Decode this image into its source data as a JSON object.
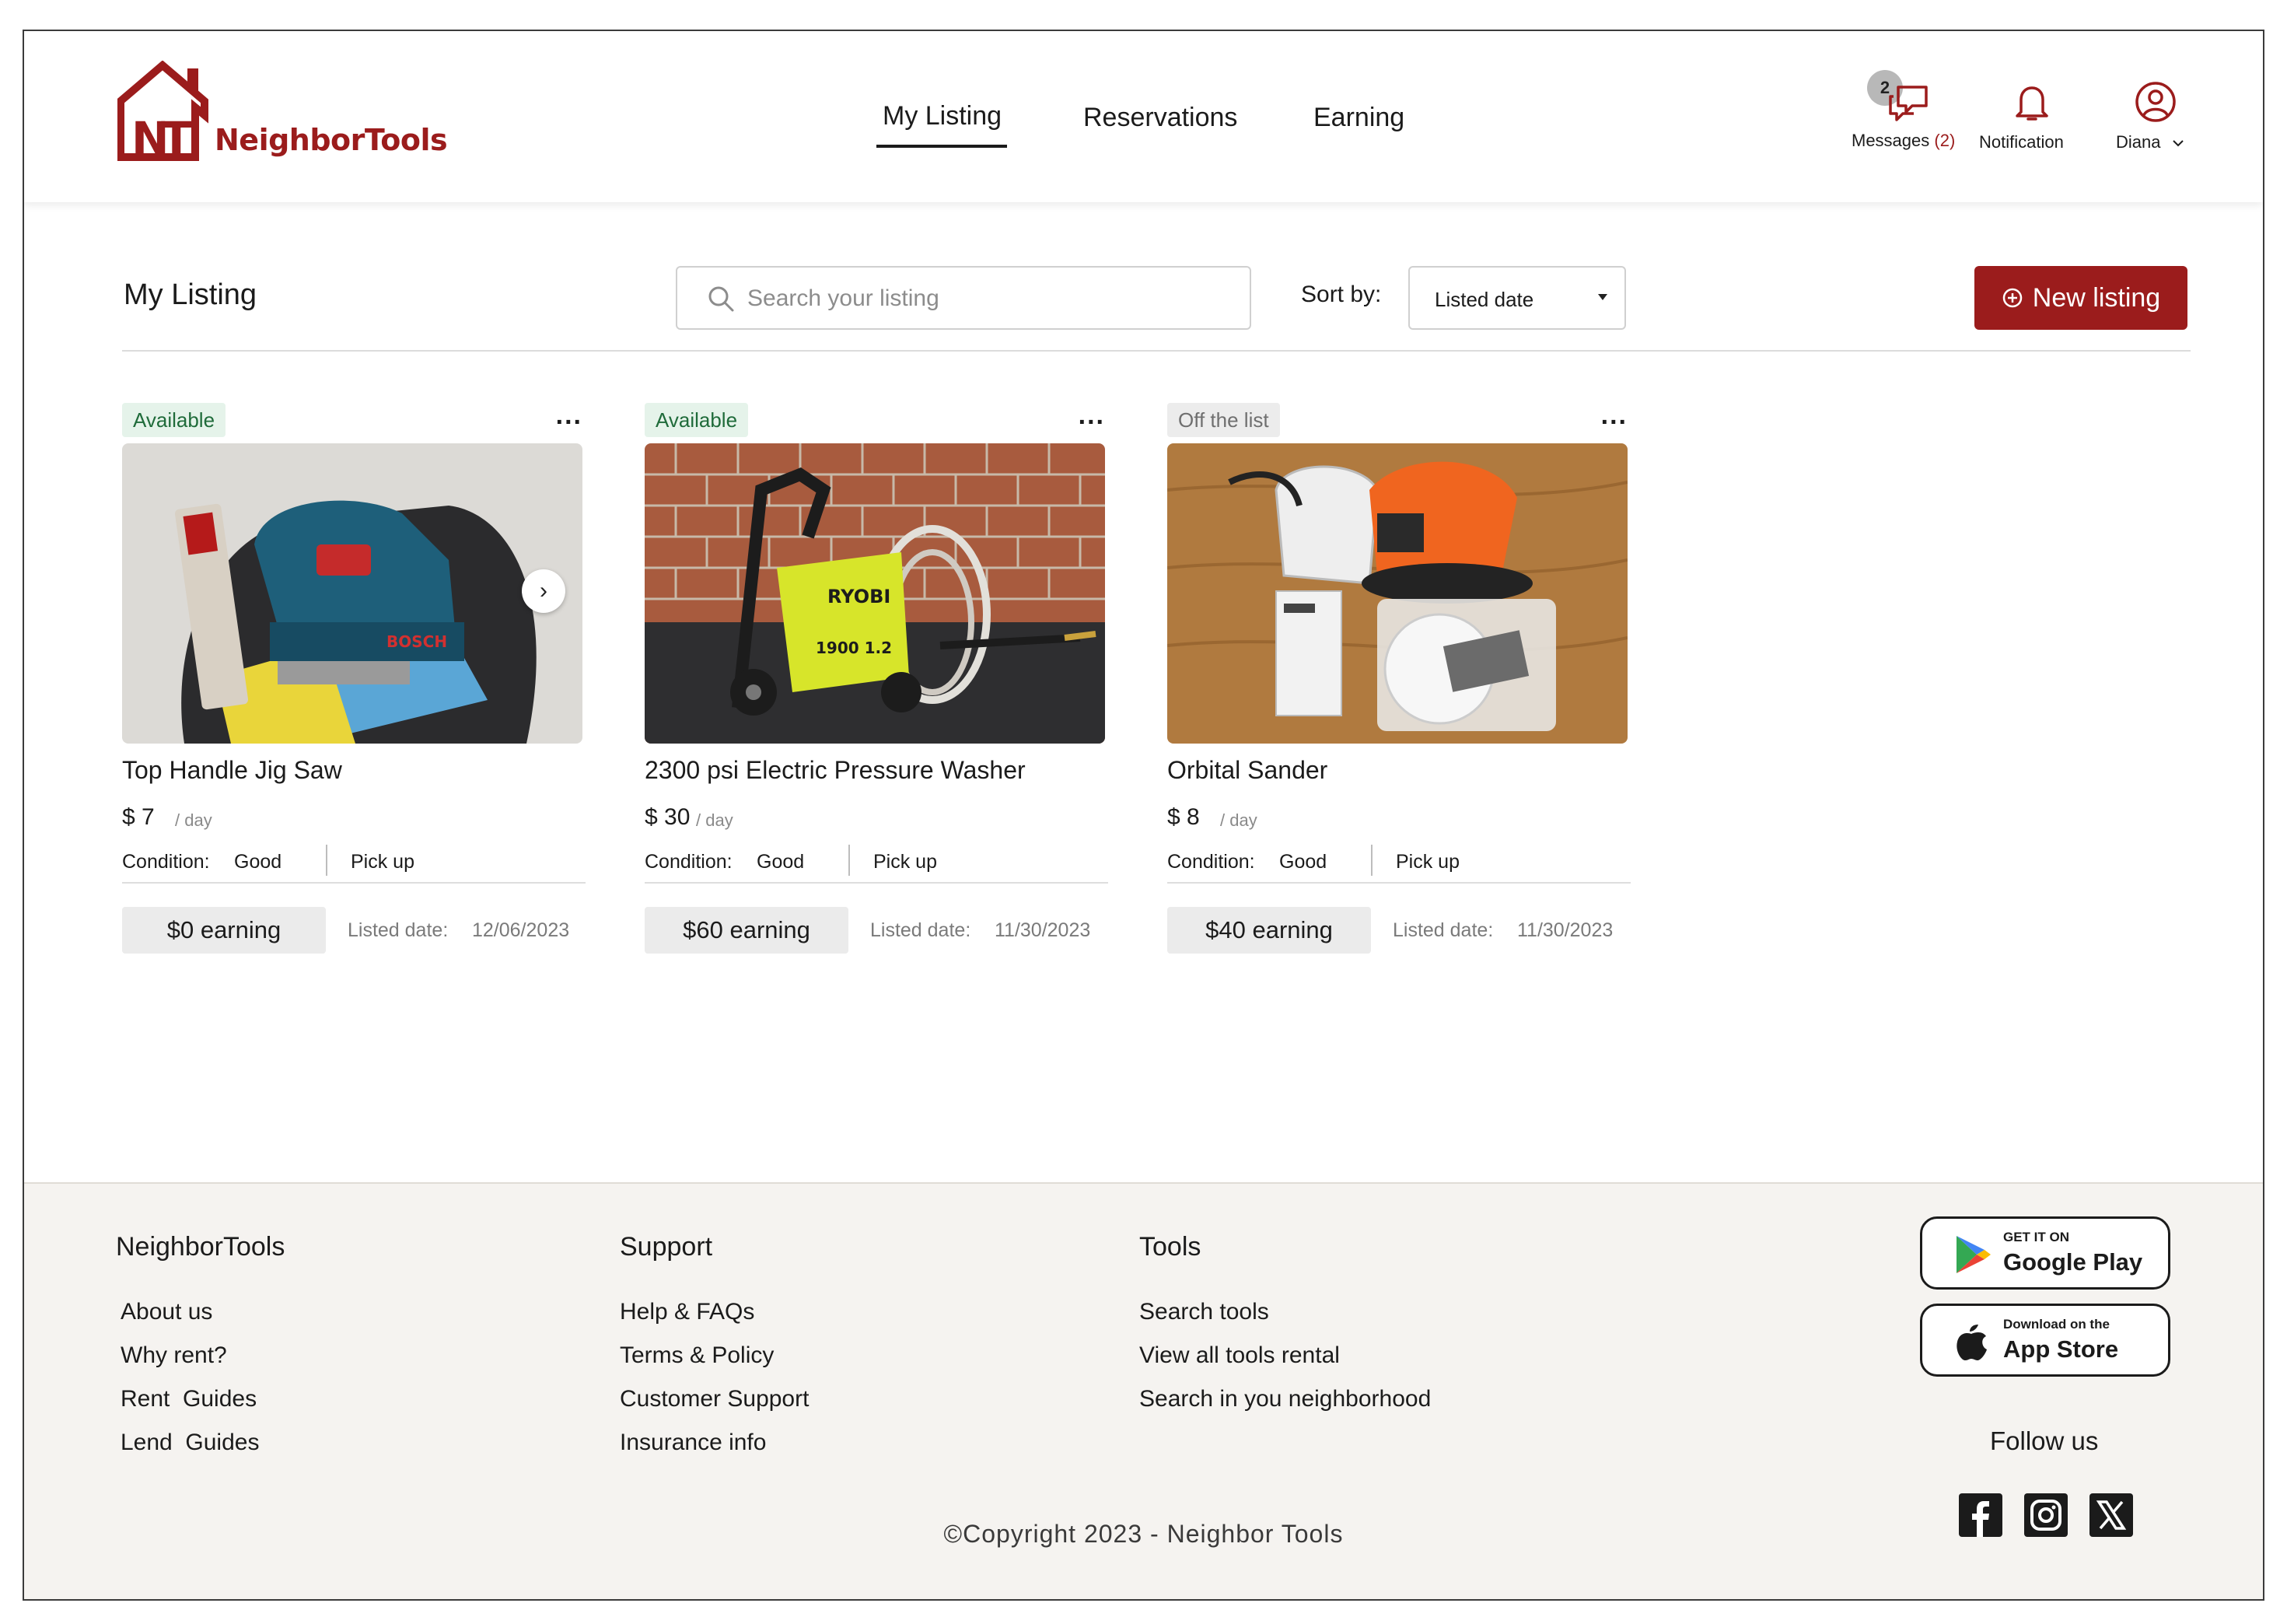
{
  "brand": {
    "name": "NeighborTools",
    "logo_letters": "NT",
    "color": "#9b1c1c"
  },
  "nav": {
    "items": [
      {
        "label": "My Listing"
      },
      {
        "label": "Reservations"
      },
      {
        "label": "Earning"
      }
    ]
  },
  "header": {
    "messages_label": "Messages",
    "messages_count": "(2)",
    "messages_badge": "2",
    "notification_label": "Notification",
    "user_name": "Diana"
  },
  "toolbar": {
    "title": "My Listing",
    "search_placeholder": "Search your listing",
    "sort_label": "Sort by:",
    "sort_value": "Listed date",
    "new_listing_label": "New listing"
  },
  "listings": [
    {
      "status": "Available",
      "title": "Top Handle Jig Saw",
      "price": "$ 7",
      "per_day": "/ day",
      "condition_label": "Condition:",
      "condition": "Good",
      "delivery": "Pick up",
      "earning": "$0 earning",
      "listed_label": "Listed date:",
      "listed_date": "12/06/2023"
    },
    {
      "status": "Available",
      "title": "2300 psi Electric Pressure Washer",
      "price": "$ 30",
      "per_day": "/ day",
      "condition_label": "Condition:",
      "condition": "Good",
      "delivery": "Pick up",
      "earning": "$60 earning",
      "listed_label": "Listed date:",
      "listed_date": "11/30/2023"
    },
    {
      "status": "Off the list",
      "title": "Orbital Sander",
      "price": "$ 8",
      "per_day": "/ day",
      "condition_label": "Condition:",
      "condition": "Good",
      "delivery": "Pick up",
      "earning": "$40 earning",
      "listed_label": "Listed date:",
      "listed_date": "11/30/2023"
    }
  ],
  "footer": {
    "col1": {
      "heading": "NeighborTools",
      "links": [
        "About us",
        "Why rent?",
        "Rent  Guides",
        "Lend  Guides"
      ]
    },
    "col2": {
      "heading": "Support",
      "links": [
        "Help & FAQs",
        "Terms & Policy",
        "Customer Support",
        "Insurance info"
      ]
    },
    "col3": {
      "heading": "Tools",
      "links": [
        "Search tools",
        "View all tools rental",
        "Search in you neighborhood"
      ]
    },
    "google_play": {
      "small": "GET IT ON",
      "big": "Google Play"
    },
    "app_store": {
      "small": "Download on the",
      "big": "App Store"
    },
    "follow_label": "Follow us",
    "social": [
      "facebook-icon",
      "instagram-icon",
      "x-icon"
    ],
    "copyright": "©Copyright 2023 - Neighbor Tools"
  }
}
